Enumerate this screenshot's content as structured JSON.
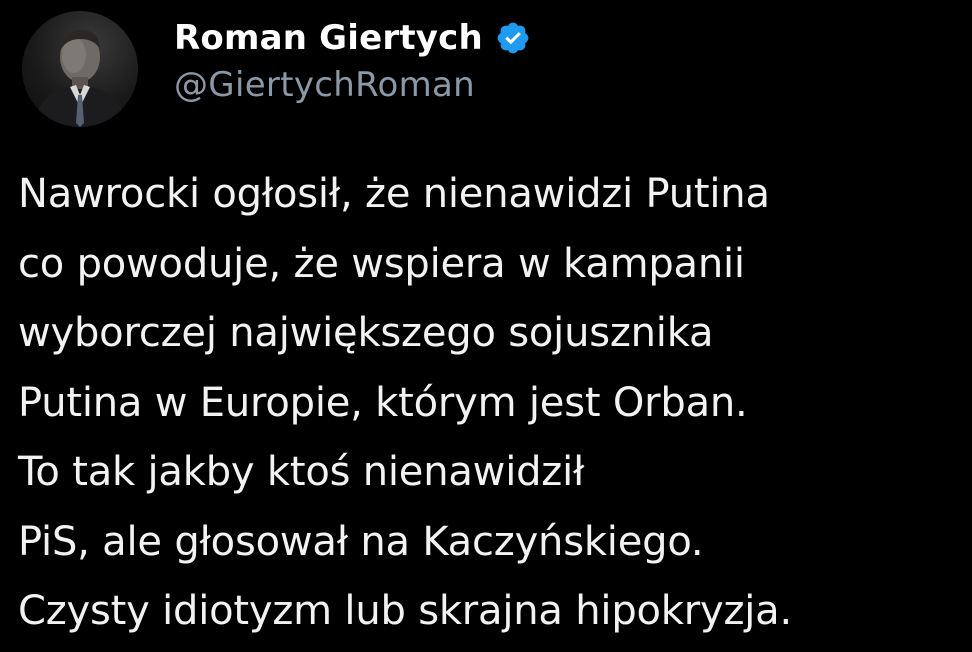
{
  "author": {
    "display_name": "Roman Giertych",
    "handle": "@GiertychRoman",
    "verified": true,
    "verified_icon": "verified-badge-icon",
    "verified_color": "#1d9bf0"
  },
  "tweet": {
    "lines": [
      "Nawrocki ogłosił, że nienawidzi Putina",
      "co powoduje, że wspiera w kampanii",
      "wyborczej największego sojusznika",
      "Putina w Europie, którym jest Orban.",
      "To tak jakby ktoś nienawidził",
      "PiS, ale głosował na Kaczyńskiego.",
      "Czysty idiotyzm lub skrajna hipokryzja."
    ]
  },
  "theme": {
    "background": "#000000",
    "text_primary": "#ffffff",
    "text_secondary": "#8b98a5"
  }
}
